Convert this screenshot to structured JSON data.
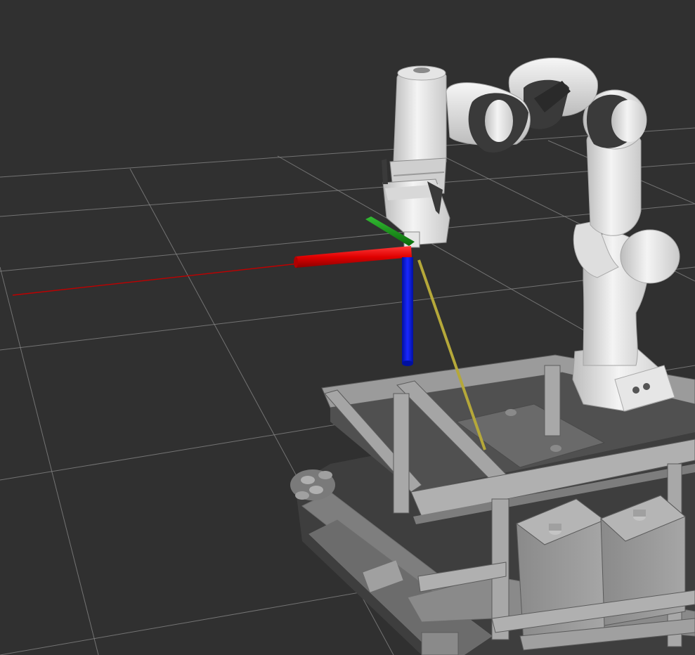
{
  "viewport": {
    "background": "#303030",
    "grid_color": "#a0a0a0"
  },
  "frame_axes": {
    "x_color": "#e00000",
    "y_color": "#119911",
    "z_color": "#0a14e6"
  },
  "ray": {
    "color": "#c00000"
  },
  "link_line": {
    "color": "#b5a83a"
  },
  "robot": {
    "shell_color": "#ececec",
    "joint_color": "#3a3a3a"
  },
  "platform": {
    "frame_color": "#8c8c8c",
    "battery_color": "#9a9a9a"
  }
}
